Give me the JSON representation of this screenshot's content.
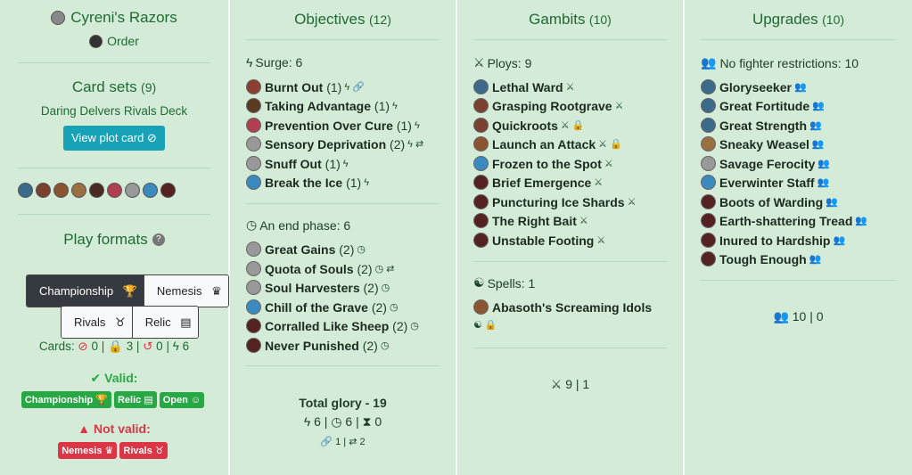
{
  "colors": {
    "panel_bg": "#d4ecd7",
    "text_green": "#1f6a34",
    "button_blue": "#17a2b8",
    "badge_green": "#28a745",
    "badge_red": "#dc3545"
  },
  "left": {
    "deck_name": "Cyreni's Razors",
    "faction": "Order",
    "card_sets_title": "Card sets",
    "card_sets_count": "(9)",
    "deck_subtitle": "Daring Delvers Rivals Deck",
    "view_plot_card": "View plot card",
    "play_formats_title": "Play formats",
    "formats": [
      "Championship",
      "Nemesis",
      "Rivals",
      "Relic"
    ],
    "cards_label": "Cards:",
    "cards_stats": [
      "0",
      "3",
      "0",
      "6"
    ],
    "valid_label": "Valid:",
    "valid_badges": [
      "Championship",
      "Relic",
      "Open"
    ],
    "not_valid_label": "Not valid:",
    "not_valid_badges": [
      "Nemesis",
      "Rivals"
    ]
  },
  "objectives": {
    "title": "Objectives",
    "count": "(12)",
    "surge_label": "Surge: 6",
    "surge_items": [
      {
        "name": "Burnt Out",
        "count": "(1)",
        "glyphs": "ϟ 🔗"
      },
      {
        "name": "Taking Advantage",
        "count": "(1)",
        "glyphs": "ϟ"
      },
      {
        "name": "Prevention Over Cure",
        "count": "(1)",
        "glyphs": "ϟ"
      },
      {
        "name": "Sensory Deprivation",
        "count": "(2)",
        "glyphs": "ϟ ⇄"
      },
      {
        "name": "Snuff Out",
        "count": "(1)",
        "glyphs": "ϟ"
      },
      {
        "name": "Break the Ice",
        "count": "(1)",
        "glyphs": "ϟ"
      }
    ],
    "end_label": "An end phase: 6",
    "end_items": [
      {
        "name": "Great Gains",
        "count": "(2)",
        "glyphs": "◷"
      },
      {
        "name": "Quota of Souls",
        "count": "(2)",
        "glyphs": "◷ ⇄"
      },
      {
        "name": "Soul Harvesters",
        "count": "(2)",
        "glyphs": "◷"
      },
      {
        "name": "Chill of the Grave",
        "count": "(2)",
        "glyphs": "◷"
      },
      {
        "name": "Corralled Like Sheep",
        "count": "(2)",
        "glyphs": "◷"
      },
      {
        "name": "Never Punished",
        "count": "(2)",
        "glyphs": "◷"
      }
    ],
    "total_glory": "Total glory - 19",
    "totals_line": "ϟ 6 | ◷ 6 | ⧗ 0",
    "totals_line2": "🔗 1 | ⇄ 2"
  },
  "gambits": {
    "title": "Gambits",
    "count": "(10)",
    "ploys_label": "Ploys: 9",
    "ploys": [
      {
        "name": "Lethal Ward",
        "lock": false
      },
      {
        "name": "Grasping Rootgrave",
        "lock": false
      },
      {
        "name": "Quickroots",
        "lock": true
      },
      {
        "name": "Launch an Attack",
        "lock": true
      },
      {
        "name": "Frozen to the Spot",
        "lock": false
      },
      {
        "name": "Brief Emergence",
        "lock": false
      },
      {
        "name": "Puncturing Ice Shards",
        "lock": false
      },
      {
        "name": "The Right Bait",
        "lock": false
      },
      {
        "name": "Unstable Footing",
        "lock": false
      }
    ],
    "spells_label": "Spells: 1",
    "spells": [
      {
        "name": "Abasoth's Screaming Idols"
      }
    ],
    "summary": "9 | 1"
  },
  "upgrades": {
    "title": "Upgrades",
    "count": "(10)",
    "restrictions_label": "No fighter restrictions: 10",
    "items": [
      "Gloryseeker",
      "Great Fortitude",
      "Great Strength",
      "Sneaky Weasel",
      "Savage Ferocity",
      "Everwinter Staff",
      "Boots of Warding",
      "Earth-shattering Tread",
      "Inured to Hardship",
      "Tough Enough"
    ],
    "summary": "10 | 0"
  }
}
